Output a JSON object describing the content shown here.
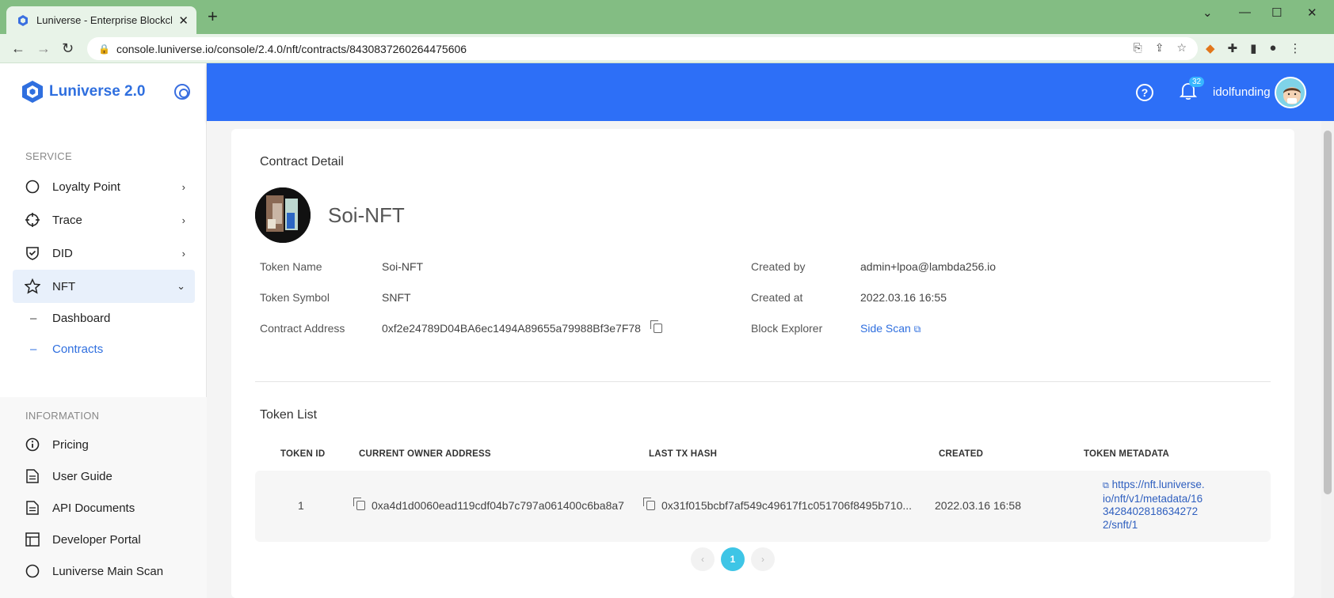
{
  "browser": {
    "tab_title": "Luniverse - Enterprise Blockchain",
    "tab_close": "✕",
    "new_tab": "+",
    "url": "console.luniverse.io/console/2.4.0/nft/contracts/8430837260264475606"
  },
  "sidebar": {
    "logo_text": "Luniverse 2.0",
    "service_label": "SERVICE",
    "service_items": [
      {
        "label": "Loyalty Point"
      },
      {
        "label": "Trace"
      },
      {
        "label": "DID"
      },
      {
        "label": "NFT"
      }
    ],
    "nft_sub": [
      {
        "label": "Dashboard"
      },
      {
        "label": "Contracts"
      }
    ],
    "information_label": "INFORMATION",
    "info_items": [
      {
        "label": "Pricing"
      },
      {
        "label": "User Guide"
      },
      {
        "label": "API Documents"
      },
      {
        "label": "Developer Portal"
      },
      {
        "label": "Luniverse Main Scan"
      }
    ]
  },
  "header": {
    "help": "?",
    "notification_count": "32",
    "username": "idolfunding"
  },
  "contract": {
    "section_title": "Contract Detail",
    "name": "Soi-NFT",
    "token_name_label": "Token Name",
    "token_name": "Soi-NFT",
    "token_symbol_label": "Token Symbol",
    "token_symbol": "SNFT",
    "contract_address_label": "Contract Address",
    "contract_address": "0xf2e24789D04BA6ec1494A89655a79988Bf3e7F78",
    "created_by_label": "Created by",
    "created_by": "admin+lpoa@lambda256.io",
    "created_at_label": "Created at",
    "created_at": "2022.03.16 16:55",
    "block_explorer_label": "Block Explorer",
    "block_explorer": "Side Scan"
  },
  "token_list": {
    "title": "Token List",
    "columns": [
      "TOKEN ID",
      "CURRENT OWNER ADDRESS",
      "LAST TX HASH",
      "CREATED",
      "TOKEN METADATA"
    ],
    "rows": [
      {
        "token_id": "1",
        "owner": "0xa4d1d0060ead119cdf04b7c797a061400c6ba8a7",
        "tx_hash": "0x31f015bcbf7af549c49617f1c051706f8495b710...",
        "created": "2022.03.16 16:58",
        "metadata": "https://nft.luniverse.io/nft/v1/metadata/1634284028186342722/snft/1"
      }
    ],
    "pagination": {
      "prev": "‹",
      "current": "1",
      "next": "›"
    }
  },
  "colors": {
    "header_bg": "#2d6ff7",
    "accent": "#2f6fdf",
    "page_active": "#3ec5e6"
  }
}
